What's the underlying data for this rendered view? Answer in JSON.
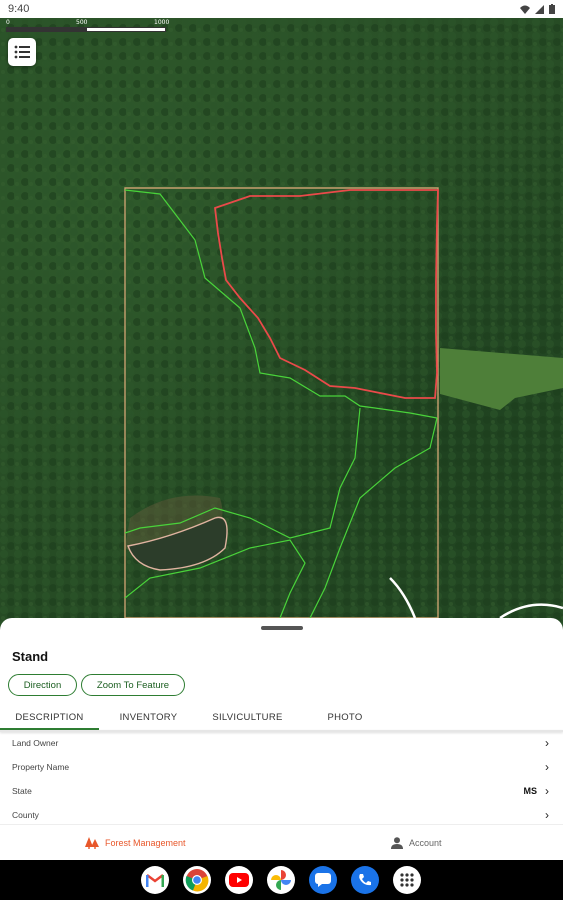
{
  "status_bar": {
    "time": "9:40",
    "icons": [
      "wifi-icon",
      "signal-icon",
      "battery-icon"
    ]
  },
  "map": {
    "scale_labels": [
      "0",
      "500",
      "1000"
    ],
    "colors": {
      "boundary": "#c8a070",
      "stand_outline": "#49d33a",
      "selected_stand": "#ea4a4a",
      "road": "#ffffff"
    }
  },
  "menu_button": {
    "icon": "list-icon"
  },
  "sheet": {
    "title": "Stand",
    "buttons": {
      "direction": "Direction",
      "zoom": "Zoom To Feature"
    },
    "tabs": [
      "DESCRIPTION",
      "INVENTORY",
      "SILVICULTURE",
      "PHOTO"
    ],
    "active_tab": "DESCRIPTION",
    "rows": [
      {
        "label": "Land Owner",
        "value": ""
      },
      {
        "label": "Property Name",
        "value": ""
      },
      {
        "label": "State",
        "value": "MS"
      },
      {
        "label": "County",
        "value": ""
      }
    ]
  },
  "bottom_nav": {
    "forest": {
      "label": "Forest Management",
      "icon": "trees-icon",
      "color": "#e8572a"
    },
    "account": {
      "label": "Account",
      "icon": "person-icon"
    }
  },
  "taskbar": {
    "apps": [
      "gmail-icon",
      "chrome-icon",
      "youtube-icon",
      "photos-icon",
      "messages-icon",
      "phone-icon",
      "app-drawer-icon"
    ]
  }
}
